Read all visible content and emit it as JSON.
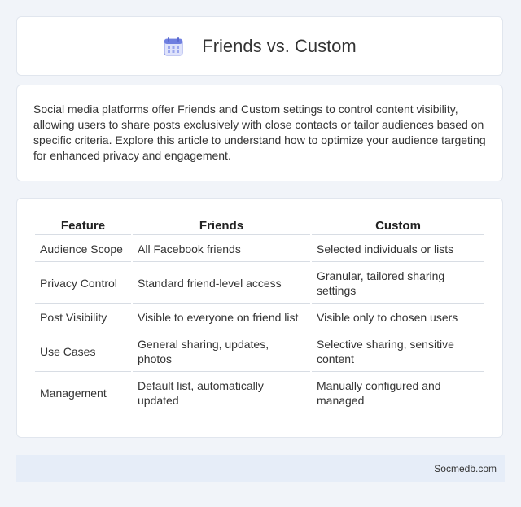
{
  "header": {
    "title": "Friends vs. Custom",
    "icon": "calendar-icon"
  },
  "intro": {
    "text": "Social media platforms offer Friends and Custom settings to control content visibility, allowing users to share posts exclusively with close contacts or tailor audiences based on specific criteria. Explore this article to understand how to optimize your audience targeting for enhanced privacy and engagement."
  },
  "table": {
    "headers": [
      "Feature",
      "Friends",
      "Custom"
    ],
    "rows": [
      [
        "Audience Scope",
        "All Facebook friends",
        "Selected individuals or lists"
      ],
      [
        "Privacy Control",
        "Standard friend-level access",
        "Granular, tailored sharing settings"
      ],
      [
        "Post Visibility",
        "Visible to everyone on friend list",
        "Visible only to chosen users"
      ],
      [
        "Use Cases",
        "General sharing, updates, photos",
        "Selective sharing, sensitive content"
      ],
      [
        "Management",
        "Default list, automatically updated",
        "Manually configured and managed"
      ]
    ]
  },
  "footer": {
    "text": "Socmedb.com"
  }
}
